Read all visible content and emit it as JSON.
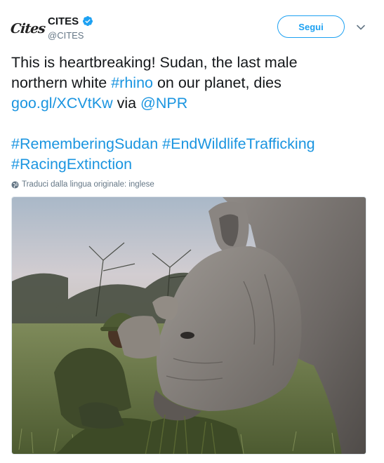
{
  "account": {
    "display_name": "CITES",
    "handle": "@CITES",
    "logo_text": "Cites"
  },
  "header": {
    "follow_label": "Segui"
  },
  "tweet": {
    "line1_text": "This is heartbreaking! Sudan, the last male",
    "line2_pre": "northern white ",
    "line2_hashtag": "#rhino",
    "line2_post": " on our planet, dies",
    "line3_link": "goo.gl/XCVtKw",
    "line3_via": " via ",
    "line3_mention": "@NPR",
    "hashtag1": "#RememberingSudan",
    "hashtag2": "#EndWildlifeTrafficking",
    "hashtag3": "#RacingExtinction"
  },
  "translate": {
    "label": "Traduci dalla lingua originale: inglese"
  },
  "colors": {
    "accent": "#1da1f2",
    "link": "#1b95e0",
    "text": "#14171a",
    "muted": "#657786"
  },
  "icons": {
    "verified": "verified-badge-icon",
    "caret": "chevron-down-icon",
    "globe": "globe-icon"
  }
}
